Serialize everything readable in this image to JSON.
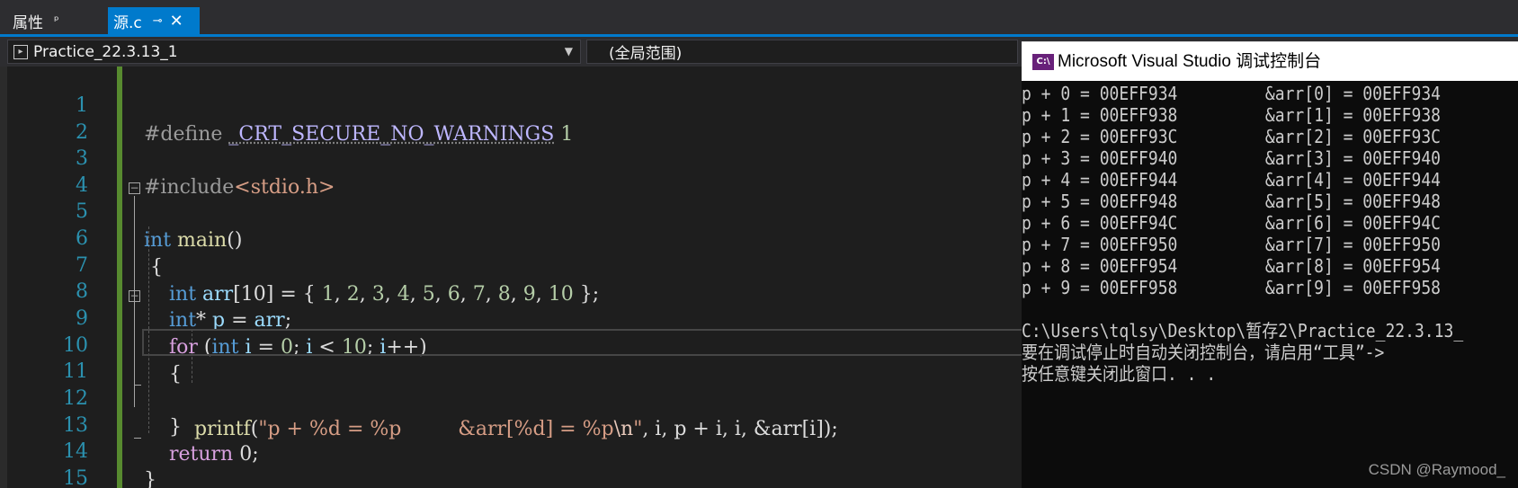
{
  "tabs": {
    "properties": "属性",
    "properties_pin": "ᵖ",
    "source": "源.c",
    "source_pin": "⊸",
    "source_close": "✕"
  },
  "navbar": {
    "project": "Practice_22.3.13_1",
    "scope": "(全局范围)"
  },
  "editor": {
    "line_numbers": [
      "1",
      "2",
      "3",
      "4",
      "5",
      "6",
      "7",
      "8",
      "9",
      "10",
      "11",
      "12",
      "13",
      "14",
      "15"
    ],
    "define_kw": "#define",
    "define_macro": "_CRT_SECURE_NO_WARNINGS",
    "define_val": "1",
    "include_kw": "#include",
    "include_file": "<stdio.h>",
    "int_kw": "int",
    "main_fn": "main",
    "main_parens": "()",
    "open_brace": "{",
    "close_brace": "}",
    "arr_name": "arr",
    "arr_size": "[10] = { ",
    "arr_values": [
      "1",
      "2",
      "3",
      "4",
      "5",
      "6",
      "7",
      "8",
      "9",
      "10"
    ],
    "arr_end": " };",
    "ptr_decl": "* ",
    "ptr_name": "p",
    "ptr_assign": " = ",
    "ptr_end": ";",
    "for_kw": "for",
    "for_open": " (",
    "loop_var": "i",
    "for_eq": " = ",
    "zero": "0",
    "for_cond": "; ",
    "for_lt": " < ",
    "ten": "10",
    "for_inc": "++)",
    "printf_fn": "printf",
    "printf_open": "(",
    "fmt_string": "\"p + %d = %p         &arr[%d] = %p",
    "fmt_escape": "\\n",
    "fmt_close": "\"",
    "printf_args": ", i, p + i, i, &arr[i]);",
    "return_kw": "return",
    "return_val": " 0;"
  },
  "console": {
    "title": "Microsoft Visual Studio 调试控制台",
    "icon": "C:\\",
    "lines": [
      "p + 0 = 00EFF934         &arr[0] = 00EFF934",
      "p + 1 = 00EFF938         &arr[1] = 00EFF938",
      "p + 2 = 00EFF93C         &arr[2] = 00EFF93C",
      "p + 3 = 00EFF940         &arr[3] = 00EFF940",
      "p + 4 = 00EFF944         &arr[4] = 00EFF944",
      "p + 5 = 00EFF948         &arr[5] = 00EFF948",
      "p + 6 = 00EFF94C         &arr[6] = 00EFF94C",
      "p + 7 = 00EFF950         &arr[7] = 00EFF950",
      "p + 8 = 00EFF954         &arr[8] = 00EFF954",
      "p + 9 = 00EFF958         &arr[9] = 00EFF958",
      "",
      "C:\\Users\\tqlsy\\Desktop\\暂存2\\Practice_22.3.13_",
      "要在调试停止时自动关闭控制台，请启用“工具”->",
      "按任意键关闭此窗口. . ."
    ],
    "watermark": "CSDN @Raymood_"
  }
}
